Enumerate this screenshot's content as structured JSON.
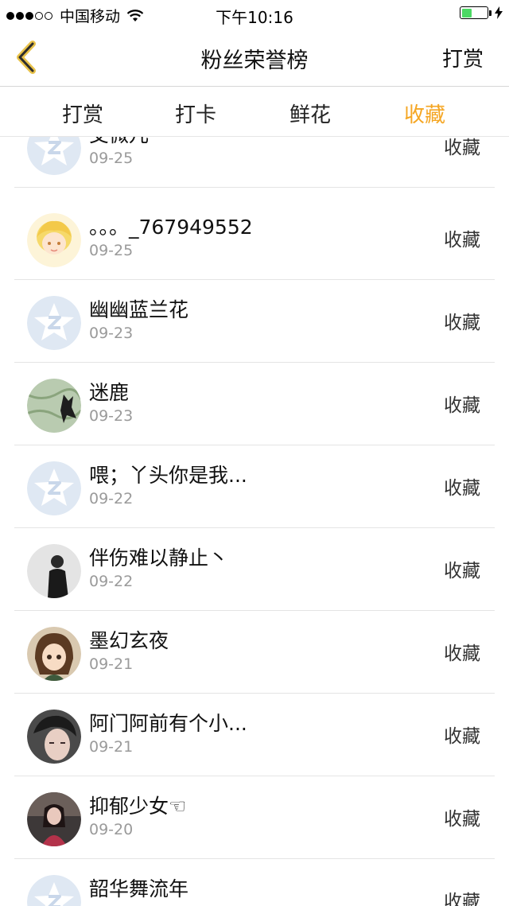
{
  "status_bar": {
    "carrier": "中国移动",
    "time": "下午10:16",
    "battery_color": "#4cd964",
    "signal_filled": 3,
    "signal_total": 5,
    "battery_level": 0.4
  },
  "nav": {
    "title": "粉丝荣誉榜",
    "right_label": "打赏"
  },
  "tabs": [
    {
      "label": "打赏"
    },
    {
      "label": "打卡"
    },
    {
      "label": "鲜花"
    },
    {
      "label": "收藏",
      "active": true
    }
  ],
  "accent_color": "#f5a623",
  "fans": [
    {
      "name": "艾微儿",
      "date": "09-25",
      "action": "收藏",
      "avatar": "default-qq-star"
    },
    {
      "name": "。。。_767949552",
      "date": "09-25",
      "action": "收藏",
      "avatar": "anime-girl-yellow"
    },
    {
      "name": "幽幽蓝兰花",
      "date": "09-23",
      "action": "收藏",
      "avatar": "default-qq-star"
    },
    {
      "name": "迷鹿",
      "date": "09-23",
      "action": "收藏",
      "avatar": "map-silhouette"
    },
    {
      "name": "喂；丫头你是我...",
      "date": "09-22",
      "action": "收藏",
      "avatar": "default-qq-star"
    },
    {
      "name": "伴伤难以静止丶",
      "date": "09-22",
      "action": "收藏",
      "avatar": "person-dark-coat"
    },
    {
      "name": "墨幻玄夜",
      "date": "09-21",
      "action": "收藏",
      "avatar": "anime-character"
    },
    {
      "name": "阿门阿前有个小...",
      "date": "09-21",
      "action": "收藏",
      "avatar": "person-portrait"
    },
    {
      "name": "抑郁少女☜",
      "date": "09-20",
      "action": "收藏",
      "avatar": "girl-photo"
    },
    {
      "name": "韶华舞流年",
      "date": "",
      "action": "收藏",
      "avatar": "default-qq-star"
    }
  ]
}
